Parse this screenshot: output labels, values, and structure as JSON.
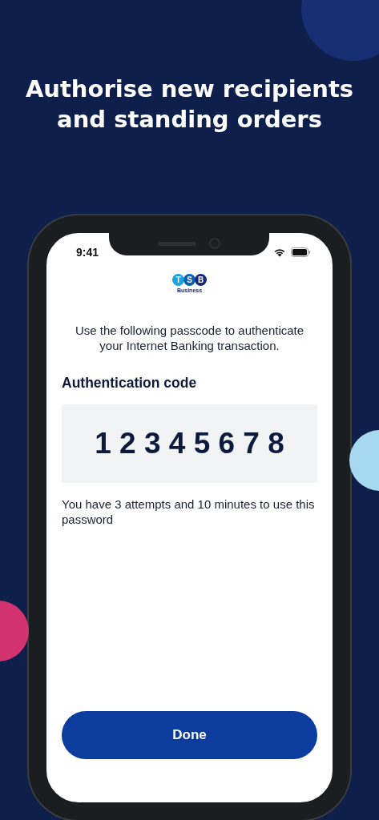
{
  "headline": "Authorise new recipients and standing orders",
  "status_bar": {
    "time": "9:41"
  },
  "logo": {
    "letters": [
      {
        "text": "T",
        "color": "#1aa3dd"
      },
      {
        "text": "S",
        "color": "#0a5fb4"
      },
      {
        "text": "B",
        "color": "#122a78"
      }
    ],
    "caption": "Business"
  },
  "instruction": "Use the following passcode to authenticate your Internet Banking transaction.",
  "code_label": "Authentication code",
  "code": "1 2 3 4 5 6 7 8",
  "note": "You have 3 attempts and 10 minutes to use this password",
  "done_button": "Done"
}
